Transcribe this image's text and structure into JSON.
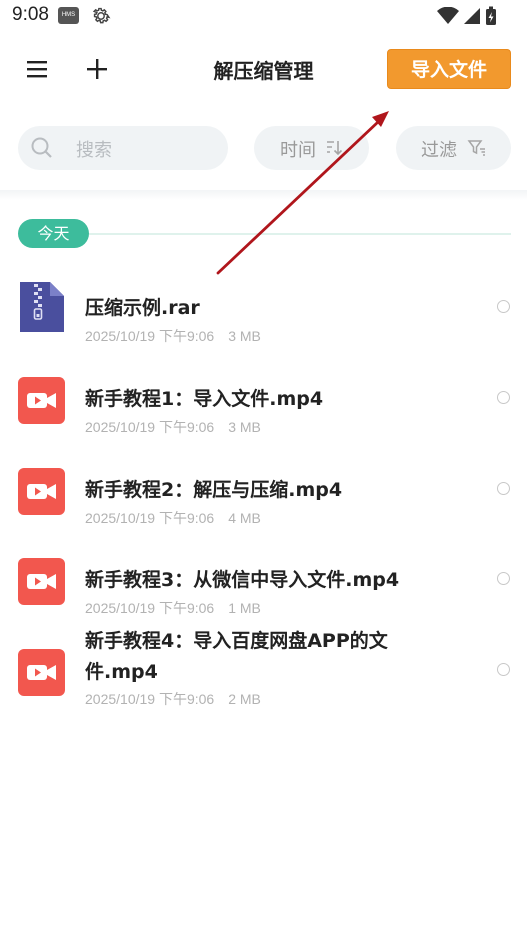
{
  "status_bar": {
    "time": "9:08",
    "hms_badge": "HMS"
  },
  "header": {
    "title": "解压缩管理",
    "import_button": "导入文件"
  },
  "search": {
    "placeholder": "搜索"
  },
  "sort": {
    "label": "时间"
  },
  "filter": {
    "label": "过滤"
  },
  "section": {
    "label": "今天"
  },
  "files": [
    {
      "name": "压缩示例.rar",
      "date": "2025/10/19 下午9:06",
      "size": "3 MB",
      "type": "rar-icon"
    },
    {
      "name": "新手教程1：导入文件.mp4",
      "date": "2025/10/19 下午9:06",
      "size": "3 MB",
      "type": "video-icon"
    },
    {
      "name": "新手教程2：解压与压缩.mp4",
      "date": "2025/10/19 下午9:06",
      "size": "4 MB",
      "type": "video-icon"
    },
    {
      "name": "新手教程3：从微信中导入文件.mp4",
      "date": "2025/10/19 下午9:06",
      "size": "1 MB",
      "type": "video-icon"
    },
    {
      "name_line1": "新手教程4：导入百度网盘APP的文",
      "name_line2": "件.mp4",
      "date": "2025/10/19 下午9:06",
      "size": "2 MB",
      "type": "video-icon"
    }
  ],
  "colors": {
    "accent": "#f2992e",
    "section_badge": "#3dbc9c",
    "video_icon": "#f2574e",
    "rar_icon": "#4a4f9e",
    "annotation_arrow": "#b0161c"
  }
}
